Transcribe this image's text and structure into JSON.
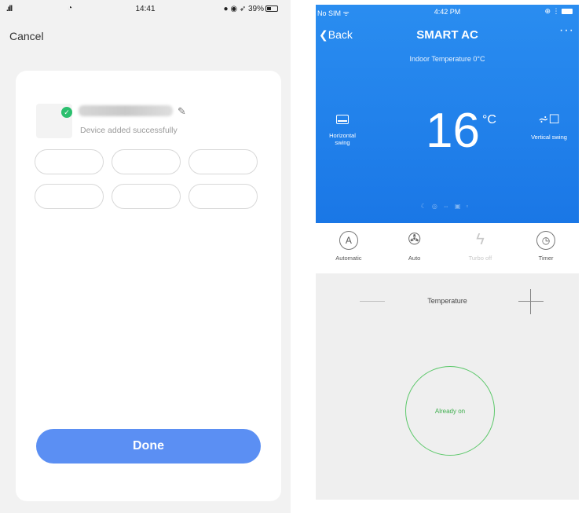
{
  "left": {
    "status": {
      "time": "14:41",
      "battery": "39%"
    },
    "cancel_label": "Cancel",
    "device_status": "Device added successfully",
    "room_chips": [
      "",
      "",
      "",
      "",
      "",
      ""
    ],
    "done_label": "Done"
  },
  "right": {
    "status": {
      "carrier": "No SIM",
      "time": "4:42 PM"
    },
    "back_label": "Back",
    "title": "SMART AC",
    "indoor_temperature": "Indoor Temperature 0°C",
    "set_temperature": "16",
    "temperature_unit": "°C",
    "horizontal_swing_label": "Horizontal swing",
    "vertical_swing_label": "Vertical swing",
    "controls": [
      {
        "label": "Automatic",
        "icon": "A"
      },
      {
        "label": "Auto",
        "icon": "fan-icon"
      },
      {
        "label": "Turbo off",
        "icon": "lightning-icon"
      },
      {
        "label": "Timer",
        "icon": "clock-icon"
      }
    ],
    "temperature_label": "Temperature",
    "power_label": "Already on"
  },
  "colors": {
    "header_blue": "#1f80ea",
    "done_button": "#5b8ff3",
    "power_ring": "#5cc86a",
    "success_check": "#2bbf6e"
  }
}
